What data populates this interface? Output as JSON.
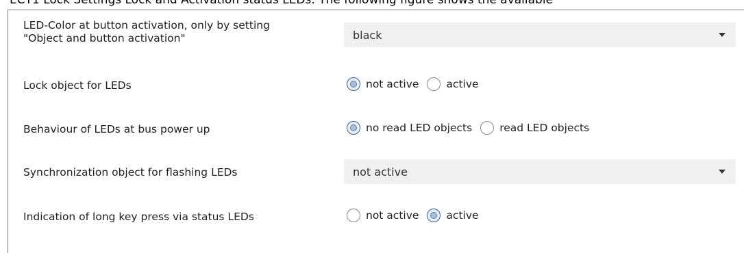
{
  "header_fragment": "ECT1 Lock Settings Lock and Activation status LEDs. The following figure shows the available",
  "rows": [
    {
      "label_line1": "LED-Color at button activation, only by setting",
      "label_line2": "\"Object and button activation\"",
      "select_value": "black"
    },
    {
      "label": "Lock object for LEDs",
      "options": [
        "not active",
        "active"
      ],
      "selected": "not active"
    },
    {
      "label": "Behaviour of LEDs at bus power up",
      "options": [
        "no read LED objects",
        "read LED objects"
      ],
      "selected": "no read LED objects"
    },
    {
      "label": "Synchronization object for flashing LEDs",
      "select_value": "not active"
    },
    {
      "label": "Indication of long key press via status LEDs",
      "options": [
        "not active",
        "active"
      ],
      "selected": "active"
    }
  ],
  "icons": {
    "dropdown": "chevron-down-icon",
    "radio": "radio-icon"
  }
}
